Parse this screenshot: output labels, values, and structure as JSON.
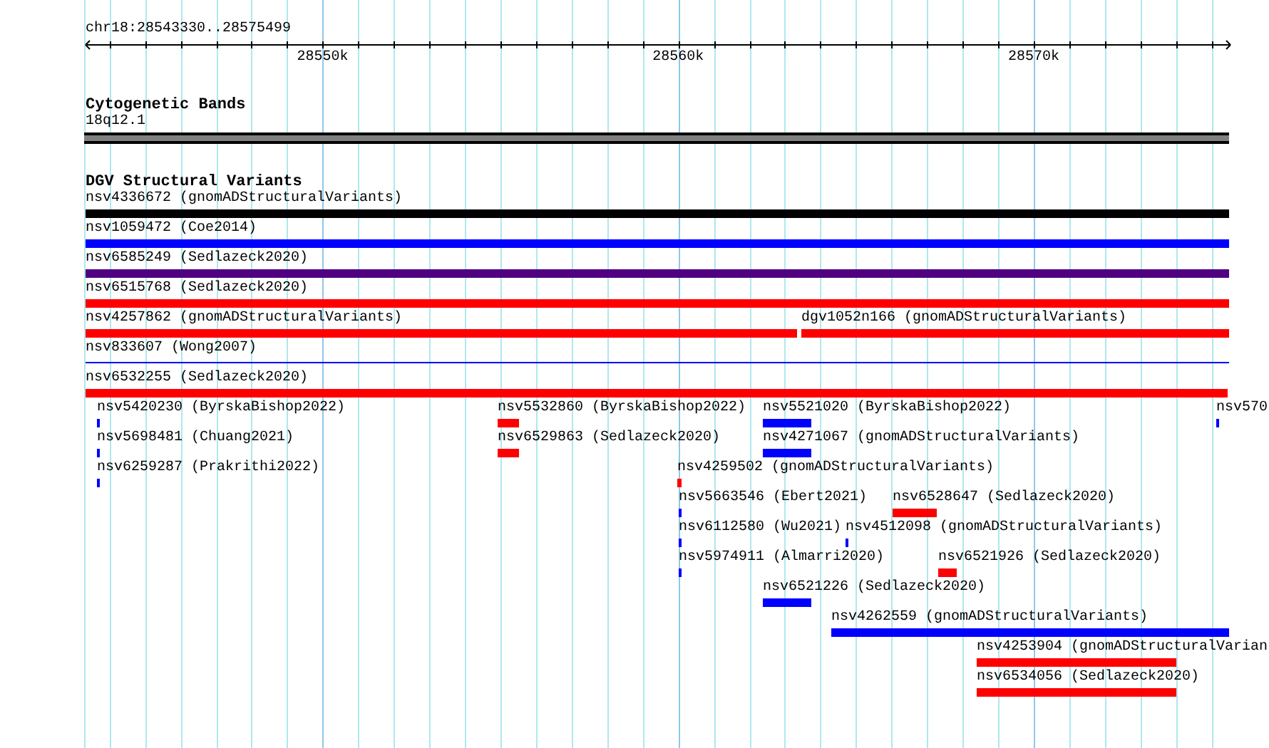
{
  "ruler": {
    "location": "chr18:28543330..28575499",
    "tick_labels": [
      "28550k",
      "28560k",
      "28570k"
    ]
  },
  "tracks": [
    {
      "title": "Cytogenetic Bands",
      "features": [
        {
          "label": "18q12.1",
          "kind": "band",
          "color": "#808080"
        }
      ]
    },
    {
      "title": "DGV Structural Variants",
      "features": [
        {
          "label": "nsv4336672 (gnomADStructuralVariants)",
          "kind": "bar",
          "color": "#000000"
        },
        {
          "label": "nsv1059472 (Coe2014)",
          "kind": "bar",
          "color": "#0000ff"
        },
        {
          "label": "nsv6585249 (Sedlazeck2020)",
          "kind": "bar",
          "color": "#500080"
        },
        {
          "label": "nsv6515768 (Sedlazeck2020)",
          "kind": "bar",
          "color": "#ff0000"
        },
        {
          "label": "nsv4257862 (gnomADStructuralVariants)",
          "kind": "bar",
          "color": "#ff0000"
        },
        {
          "label": "dgv1052n166 (gnomADStructuralVariants)",
          "kind": "bar",
          "color": "#ff0000"
        },
        {
          "label": "nsv833607 (Wong2007)",
          "kind": "line",
          "color": "#0000ff"
        },
        {
          "label": "nsv6532255 (Sedlazeck2020)",
          "kind": "bar",
          "color": "#ff0000"
        },
        {
          "label": "nsv5420230 (ByrskaBishop2022)",
          "kind": "bar",
          "color": "#0000ff"
        },
        {
          "label": "nsv5532860 (ByrskaBishop2022)",
          "kind": "bar",
          "color": "#ff0000"
        },
        {
          "label": "nsv5521020 (ByrskaBishop2022)",
          "kind": "bar",
          "color": "#0000ff"
        },
        {
          "label": "nsv570",
          "kind": "bar",
          "color": "#0000ff"
        },
        {
          "label": "nsv5698481 (Chuang2021)",
          "kind": "bar",
          "color": "#0000ff"
        },
        {
          "label": "nsv6529863 (Sedlazeck2020)",
          "kind": "bar",
          "color": "#ff0000"
        },
        {
          "label": "nsv4271067 (gnomADStructuralVariants)",
          "kind": "bar",
          "color": "#0000ff"
        },
        {
          "label": "nsv6259287 (Prakrithi2022)",
          "kind": "bar",
          "color": "#0000ff"
        },
        {
          "label": "nsv4259502 (gnomADStructuralVariants)",
          "kind": "bar",
          "color": "#ff0000"
        },
        {
          "label": "nsv5663546 (Ebert2021)",
          "kind": "bar",
          "color": "#0000ff"
        },
        {
          "label": "nsv6528647 (Sedlazeck2020)",
          "kind": "bar",
          "color": "#ff0000"
        },
        {
          "label": "nsv6112580 (Wu2021)",
          "kind": "bar",
          "color": "#0000ff"
        },
        {
          "label": "nsv4512098 (gnomADStructuralVariants)",
          "kind": "bar",
          "color": "#0000ff"
        },
        {
          "label": "nsv5974911 (Almarri2020)",
          "kind": "bar",
          "color": "#0000ff"
        },
        {
          "label": "nsv6521926 (Sedlazeck2020)",
          "kind": "bar",
          "color": "#ff0000"
        },
        {
          "label": "nsv6521226 (Sedlazeck2020)",
          "kind": "bar",
          "color": "#0000ff"
        },
        {
          "label": "nsv4262559 (gnomADStructuralVariants)",
          "kind": "bar",
          "color": "#0000ff"
        },
        {
          "label": "nsv4253904 (gnomADStructuralVarian",
          "kind": "bar",
          "color": "#ff0000"
        },
        {
          "label": "nsv6534056 (Sedlazeck2020)",
          "kind": "bar",
          "color": "#ff0000"
        }
      ]
    }
  ]
}
